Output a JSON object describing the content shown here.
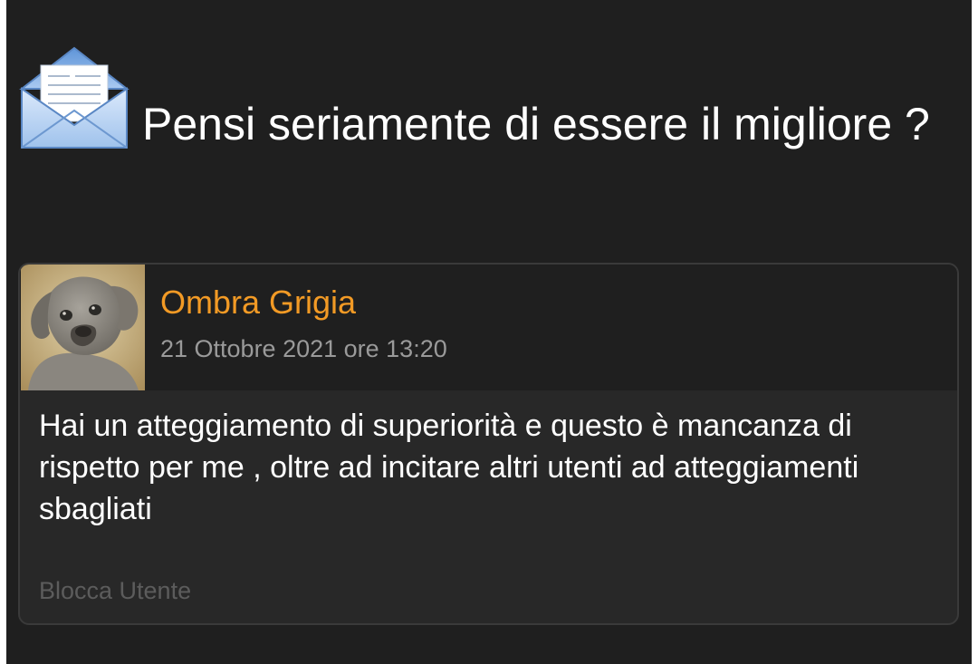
{
  "message": {
    "title": "Pensi seriamente di essere il migliore ?",
    "icon": "envelope-icon",
    "sender": "Ombra Grigia",
    "datetime": "21 Ottobre 2021 ore 13:20",
    "body": "Hai un atteggiamento di superiorità e questo è mancanza di rispetto per me , oltre ad incitare altri utenti ad atteggiamenti sbagliati",
    "block_label": "Blocca Utente"
  },
  "colors": {
    "background": "#1f1f1f",
    "card": "#282828",
    "sender": "#f29a25",
    "muted": "#9a9a9a",
    "link_disabled": "#5c5c5c"
  }
}
